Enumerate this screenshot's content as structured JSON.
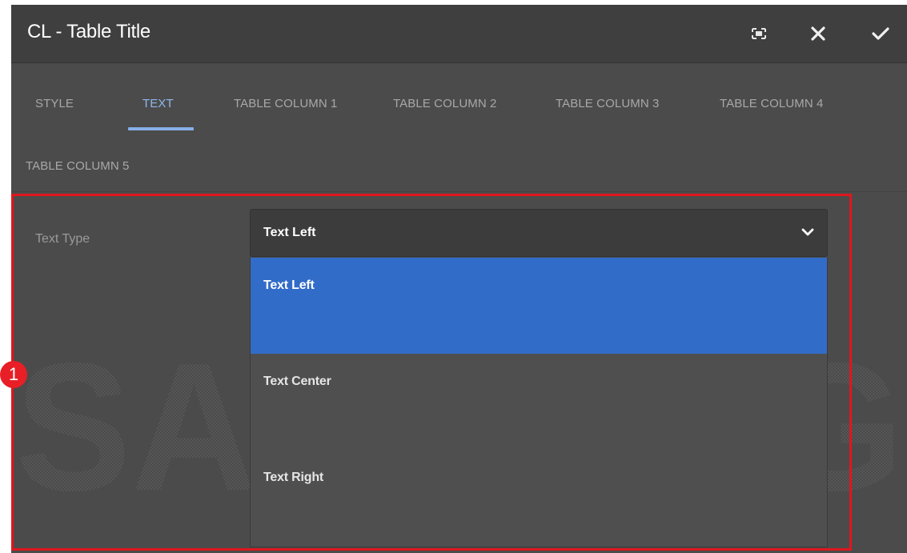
{
  "dialog": {
    "title": "CL - Table Title",
    "toolbar": {
      "fullscreen_icon": "fullscreen-icon",
      "close_icon": "close-icon",
      "confirm_icon": "checkmark-icon"
    }
  },
  "tabs": [
    {
      "label": "STYLE",
      "active": false
    },
    {
      "label": "TEXT",
      "active": true
    },
    {
      "label": "TABLE COLUMN 1",
      "active": false
    },
    {
      "label": "TABLE COLUMN 2",
      "active": false
    },
    {
      "label": "TABLE COLUMN 3",
      "active": false
    },
    {
      "label": "TABLE COLUMN 4",
      "active": false
    },
    {
      "label": "TABLE COLUMN 5",
      "active": false
    }
  ],
  "form": {
    "text_type": {
      "label": "Text Type",
      "value": "Text Left",
      "options": [
        "Text Left",
        "Text Center",
        "Text Right"
      ],
      "selected_index": 0
    }
  },
  "annotation": {
    "step_number": "1",
    "color": "#e0161d"
  },
  "watermark": {
    "text": "SAMSUNG"
  },
  "colors": {
    "accent": "#326cc9",
    "tab_active": "#8fb7ee",
    "dialog_bg": "#4b4b4b"
  }
}
